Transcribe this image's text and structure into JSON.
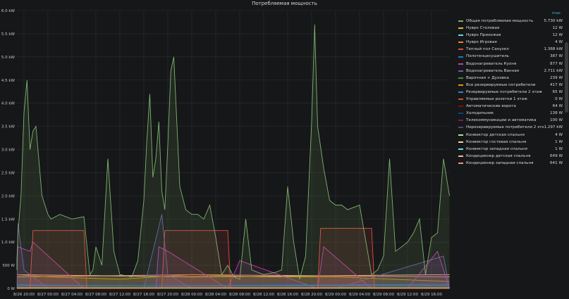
{
  "panel": {
    "title": "Потребляемая мощность",
    "sort_hint": "max"
  },
  "chart_data": {
    "type": "line",
    "title": "Потребляемая мощность",
    "ylim": [
      0,
      6000
    ],
    "y_ticks": [
      "0 W",
      "500 W",
      "1.0 kW",
      "1.5 kW",
      "2.0 kW",
      "2.5 kW",
      "3.0 kW",
      "3.5 kW",
      "4.0 kW",
      "4.5 kW",
      "5.0 kW",
      "5.5 kW",
      "6.0 kW"
    ],
    "x_ticks": [
      "8/26 20:00",
      "8/27 00:00",
      "8/27 04:00",
      "8/27 08:00",
      "8/27 12:00",
      "8/27 16:00",
      "8/27 20:00",
      "8/28 00:00",
      "8/28 04:00",
      "8/28 08:00",
      "8/28 12:00",
      "8/28 16:00",
      "8/28 20:00",
      "8/29 00:00",
      "8/29 04:00",
      "8/29 08:00",
      "8/29 12:00",
      "8/29 16:00"
    ],
    "grid": true,
    "legend_placement": "right",
    "series": [
      {
        "name": "Общая потребляемая мощность",
        "current": "5.730 kW",
        "color": "#7eb26d",
        "x": [
          "8/26 18:00",
          "8/26 18:30",
          "8/26 19:00",
          "8/26 19:30",
          "8/26 20:00",
          "8/26 20:30",
          "8/26 21:00",
          "8/26 21:30",
          "8/26 22:00",
          "8/26 23:00",
          "8/27 00:00",
          "8/27 00:30",
          "8/27 02:00",
          "8/27 04:00",
          "8/27 06:00",
          "8/27 07:00",
          "8/27 07:30",
          "8/27 08:00",
          "8/27 09:00",
          "8/27 10:00",
          "8/27 11:00",
          "8/27 12:00",
          "8/27 14:00",
          "8/27 15:00",
          "8/27 16:00",
          "8/27 16:30",
          "8/27 17:00",
          "8/27 17:30",
          "8/27 18:00",
          "8/27 18:30",
          "8/27 19:00",
          "8/27 19:30",
          "8/27 20:00",
          "8/27 20:30",
          "8/27 21:00",
          "8/27 22:00",
          "8/27 23:00",
          "8/28 00:00",
          "8/28 01:00",
          "8/28 02:00",
          "8/28 03:00",
          "8/28 04:00",
          "8/28 05:00",
          "8/28 06:00",
          "8/28 07:00",
          "8/28 08:00",
          "8/28 09:00",
          "8/28 10:00",
          "8/28 12:00",
          "8/28 14:00",
          "8/28 15:00",
          "8/28 16:00",
          "8/28 17:00",
          "8/28 18:00",
          "8/28 19:00",
          "8/28 20:00",
          "8/28 20:30",
          "8/28 21:00",
          "8/28 22:00",
          "8/28 23:00",
          "8/29 00:00",
          "8/29 01:00",
          "8/29 02:00",
          "8/29 04:00",
          "8/29 06:00",
          "8/29 07:00",
          "8/29 08:00",
          "8/29 09:00",
          "8/29 10:00",
          "8/29 11:00",
          "8/29 12:00",
          "8/29 13:00",
          "8/29 14:00",
          "8/29 15:00",
          "8/29 16:00",
          "8/29 17:00",
          "8/29 18:00",
          "8/29 19:00"
        ],
        "values": [
          400,
          600,
          1200,
          2000,
          3800,
          4500,
          3000,
          3400,
          3500,
          2000,
          1600,
          1500,
          1600,
          1500,
          1550,
          300,
          400,
          900,
          500,
          2800,
          800,
          300,
          250,
          600,
          1900,
          3200,
          4200,
          2400,
          2800,
          3600,
          2100,
          1700,
          3100,
          4700,
          5000,
          2200,
          1700,
          1600,
          1600,
          1500,
          1800,
          1100,
          300,
          500,
          250,
          200,
          1500,
          400,
          300,
          350,
          400,
          2200,
          1000,
          200,
          700,
          3600,
          5700,
          3500,
          2600,
          1900,
          1800,
          1800,
          1700,
          1800,
          300,
          400,
          700,
          2800,
          800,
          900,
          1000,
          1200,
          1500,
          300,
          1100,
          1200,
          2800,
          2000
        ]
      },
      {
        "name": "Нувро Столовая",
        "current": "12 W",
        "color": "#eab839",
        "x": [
          "8/26 18:00",
          "8/28 00:00",
          "8/29 19:00"
        ],
        "values": [
          12,
          12,
          12
        ]
      },
      {
        "name": "Нувро Прихожая",
        "current": "12 W",
        "color": "#6ed0e0",
        "x": [
          "8/26 18:00",
          "8/28 00:00",
          "8/29 19:00"
        ],
        "values": [
          12,
          12,
          12
        ]
      },
      {
        "name": "Нувро Игровая",
        "current": "4 W",
        "color": "#ef843c",
        "x": [
          "8/26 18:00",
          "8/28 00:00",
          "8/29 19:00"
        ],
        "values": [
          4,
          4,
          4
        ]
      },
      {
        "name": "Теплый пол Санузел",
        "current": "1.368 kW",
        "color": "#e24d42",
        "x": [
          "8/26 18:00",
          "8/26 21:00",
          "8/26 21:30",
          "8/27 06:00",
          "8/27 06:30",
          "8/27 18:00",
          "8/27 19:00",
          "8/27 19:30",
          "8/28 06:00",
          "8/28 06:30",
          "8/28 21:00",
          "8/28 21:30",
          "8/29 06:00",
          "8/29 06:30",
          "8/29 19:00"
        ],
        "values": [
          0,
          0,
          1250,
          1250,
          0,
          0,
          0,
          1250,
          1250,
          0,
          0,
          1300,
          1300,
          0,
          0
        ]
      },
      {
        "name": "Полотенцесушитель",
        "current": "387 W",
        "color": "#1f78c1",
        "x": [
          "8/26 18:00",
          "8/27 12:00",
          "8/28 12:00",
          "8/29 19:00"
        ],
        "values": [
          80,
          60,
          70,
          90
        ]
      },
      {
        "name": "Водонагреватель Кухня",
        "current": "877 W",
        "color": "#ba43a9",
        "x": [
          "8/26 18:00",
          "8/26 19:00",
          "8/26 21:00",
          "8/26 21:30",
          "8/27 06:00",
          "8/27 18:00",
          "8/27 18:30",
          "8/27 20:00",
          "8/28 06:00",
          "8/28 08:00",
          "8/28 21:00",
          "8/28 22:00",
          "8/29 06:00",
          "8/29 12:00",
          "8/29 17:00",
          "8/29 19:00"
        ],
        "values": [
          600,
          900,
          800,
          1000,
          0,
          0,
          900,
          800,
          0,
          600,
          0,
          900,
          0,
          0,
          800,
          0
        ]
      },
      {
        "name": "Водонагреватель Ванная",
        "current": "2.711 kW",
        "color": "#705da0",
        "x": [
          "8/26 18:00",
          "8/26 19:00",
          "8/26 20:00",
          "8/27 00:00",
          "8/27 16:00",
          "8/27 19:00",
          "8/27 20:00",
          "8/28 00:00",
          "8/28 12:00",
          "8/29 00:00",
          "8/29 18:00",
          "8/29 19:00"
        ],
        "values": [
          0,
          1400,
          400,
          0,
          0,
          1600,
          300,
          0,
          0,
          0,
          700,
          0
        ]
      },
      {
        "name": "Варочная + Духовка",
        "current": "239 W",
        "color": "#508642",
        "x": [
          "8/26 18:00",
          "8/28 00:00",
          "8/29 19:00"
        ],
        "values": [
          0,
          0,
          0
        ]
      },
      {
        "name": "Все резервируемые потребители",
        "current": "417 W",
        "color": "#cca300",
        "x": [
          "8/26 18:00",
          "8/27 00:00",
          "8/27 12:00",
          "8/28 00:00",
          "8/28 12:00",
          "8/29 00:00",
          "8/29 19:00"
        ],
        "values": [
          300,
          250,
          200,
          300,
          250,
          250,
          150
        ]
      },
      {
        "name": "Резервируемые потребители 2 этаж",
        "current": "65 W",
        "color": "#447ebc",
        "x": [
          "8/26 18:00",
          "8/28 00:00",
          "8/29 19:00"
        ],
        "values": [
          65,
          60,
          65
        ]
      },
      {
        "name": "Управляемые розетки 1 этаж",
        "current": "0 W",
        "color": "#c15c17",
        "x": [
          "8/26 18:00",
          "8/28 00:00",
          "8/29 19:00"
        ],
        "values": [
          0,
          0,
          0
        ]
      },
      {
        "name": "Автоматические ворота",
        "current": "64 W",
        "color": "#890f02",
        "x": [
          "8/26 18:00",
          "8/28 00:00",
          "8/29 19:00"
        ],
        "values": [
          60,
          60,
          60
        ]
      },
      {
        "name": "Холодильник",
        "current": "138 W",
        "color": "#0a437c",
        "x": [
          "8/26 18:00",
          "8/28 00:00",
          "8/29 19:00"
        ],
        "values": [
          130,
          130,
          130
        ]
      },
      {
        "name": "Телекоммуникации и автоматика",
        "current": "100 W",
        "color": "#6d1f62",
        "x": [
          "8/26 18:00",
          "8/28 00:00",
          "8/29 19:00"
        ],
        "values": [
          100,
          100,
          100
        ]
      },
      {
        "name": "Нерезервируемые потребители 2 этаж",
        "current": "1.297 kW",
        "color": "#584477",
        "x": [
          "8/26 18:00",
          "8/28 00:00",
          "8/29 19:00"
        ],
        "values": [
          100,
          100,
          100
        ]
      },
      {
        "name": "Конвектор детская спальня",
        "current": "4 W",
        "color": "#b7dbab",
        "x": [
          "8/26 18:00",
          "8/28 00:00",
          "8/29 19:00"
        ],
        "values": [
          4,
          4,
          4
        ]
      },
      {
        "name": "Конвектор гостевая спальня",
        "current": "1 W",
        "color": "#f4d598",
        "x": [
          "8/26 18:00",
          "8/28 00:00",
          "8/29 19:00"
        ],
        "values": [
          1,
          1,
          1
        ]
      },
      {
        "name": "Конвектор западная спальня",
        "current": "1 W",
        "color": "#70dbed",
        "x": [
          "8/26 18:00",
          "8/28 00:00",
          "8/29 19:00"
        ],
        "values": [
          1,
          1,
          1
        ]
      },
      {
        "name": "Кондиционер детская спальня",
        "current": "649 W",
        "color": "#f9ba8f",
        "x": [
          "8/26 18:00",
          "8/28 00:00",
          "8/29 19:00"
        ],
        "values": [
          300,
          250,
          300
        ]
      },
      {
        "name": "Кондиционер западная спальня",
        "current": "641 W",
        "color": "#f29191",
        "x": [
          "8/26 18:00",
          "8/28 00:00",
          "8/29 19:00"
        ],
        "values": [
          250,
          300,
          250
        ]
      }
    ]
  }
}
